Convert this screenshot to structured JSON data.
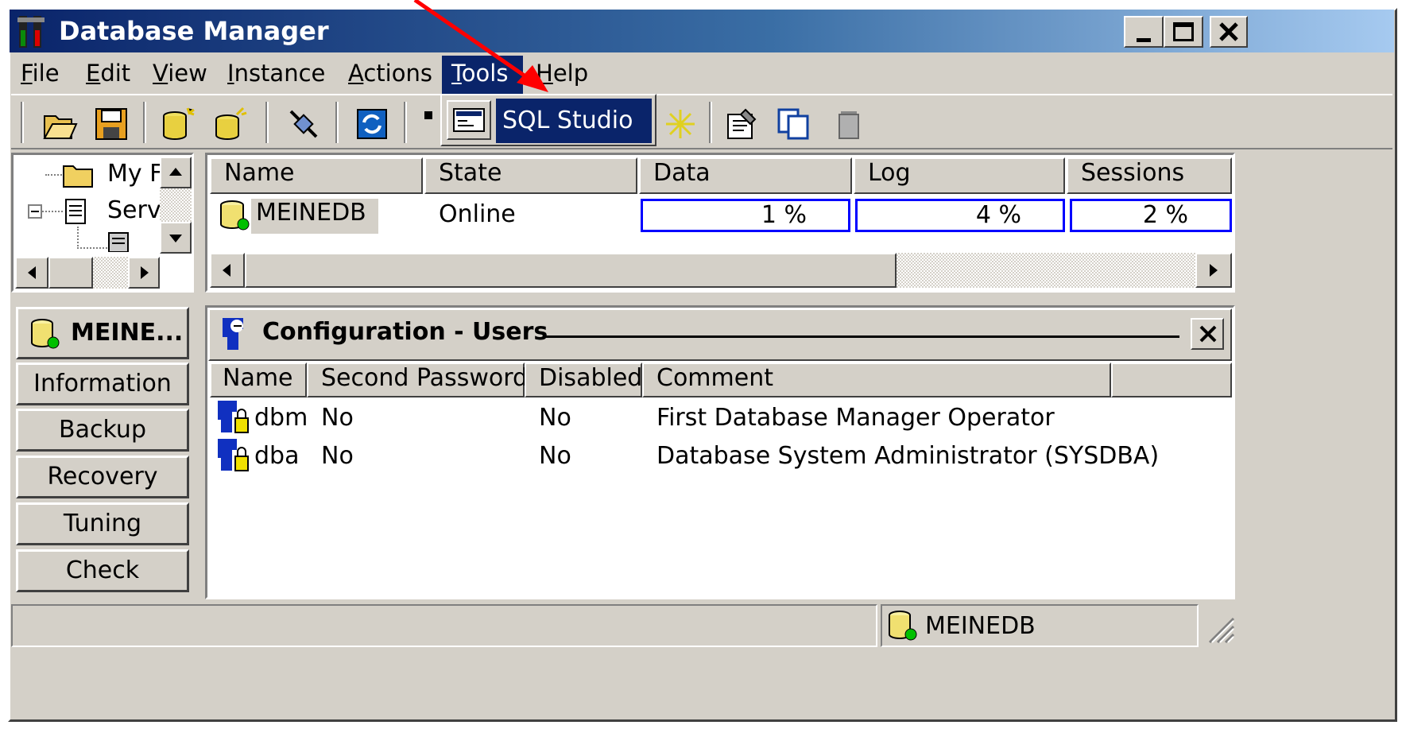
{
  "window": {
    "title": "Database Manager"
  },
  "menu": {
    "items": [
      "File",
      "Edit",
      "View",
      "Instance",
      "Actions",
      "Tools",
      "Help"
    ],
    "underline": [
      "F",
      "E",
      "V",
      "I",
      "A",
      "T",
      "H"
    ],
    "active": "Tools"
  },
  "dropdown": {
    "item": "SQL Studio"
  },
  "tree": {
    "items": [
      "My F",
      "Serv"
    ]
  },
  "instances": {
    "headers": [
      "Name",
      "State",
      "Data",
      "Log",
      "Sessions"
    ],
    "rows": [
      {
        "name": "MEINEDB",
        "state": "Online",
        "data": "1 %",
        "log": "4 %",
        "sessions": "2 %"
      }
    ]
  },
  "nav": {
    "db_name": "MEINE...",
    "buttons": [
      "Information",
      "Backup",
      "Recovery",
      "Tuning",
      "Check"
    ]
  },
  "panel": {
    "title": "Configuration - Users",
    "headers": [
      "Name",
      "Second Password",
      "Disabled",
      "Comment"
    ],
    "rows": [
      {
        "name": "dbm",
        "second_password": "No",
        "disabled": "No",
        "comment": "First Database Manager Operator"
      },
      {
        "name": "dba",
        "second_password": "No",
        "disabled": "No",
        "comment": "Database System Administrator (SYSDBA)"
      }
    ]
  },
  "statusbar": {
    "db": "MEINEDB"
  },
  "colors": {
    "title_start": "#0a246a",
    "title_end": "#a6caf0",
    "face": "#d4d0c8",
    "selection": "#0a246a",
    "annotation": "#ff0000",
    "progress_border": "#0000ff"
  },
  "icons": [
    "app-icon",
    "open-folder-icon",
    "save-icon",
    "new-db-icon",
    "new-db-wizard-icon",
    "connect-icon",
    "refresh-icon",
    "sql-studio-icon",
    "star-icon",
    "properties-icon",
    "copy-icon",
    "delete-icon",
    "folder-icon",
    "server-icon",
    "database-icon",
    "user-icon"
  ]
}
